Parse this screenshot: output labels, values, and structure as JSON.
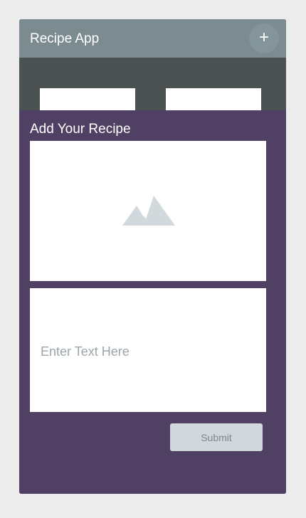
{
  "header": {
    "title": "Recipe App",
    "add_label": "+"
  },
  "form": {
    "title": "Add Your Recipe",
    "image_placeholder_icon": "image-icon",
    "text_placeholder": "Enter Text Here",
    "text_value": "",
    "submit_label": "Submit"
  },
  "colors": {
    "header_bg": "#7b8b90",
    "app_bg": "#4c5152",
    "form_bg": "#4f4064",
    "submit_bg": "#d1d8db",
    "page_bg": "#ececec"
  }
}
